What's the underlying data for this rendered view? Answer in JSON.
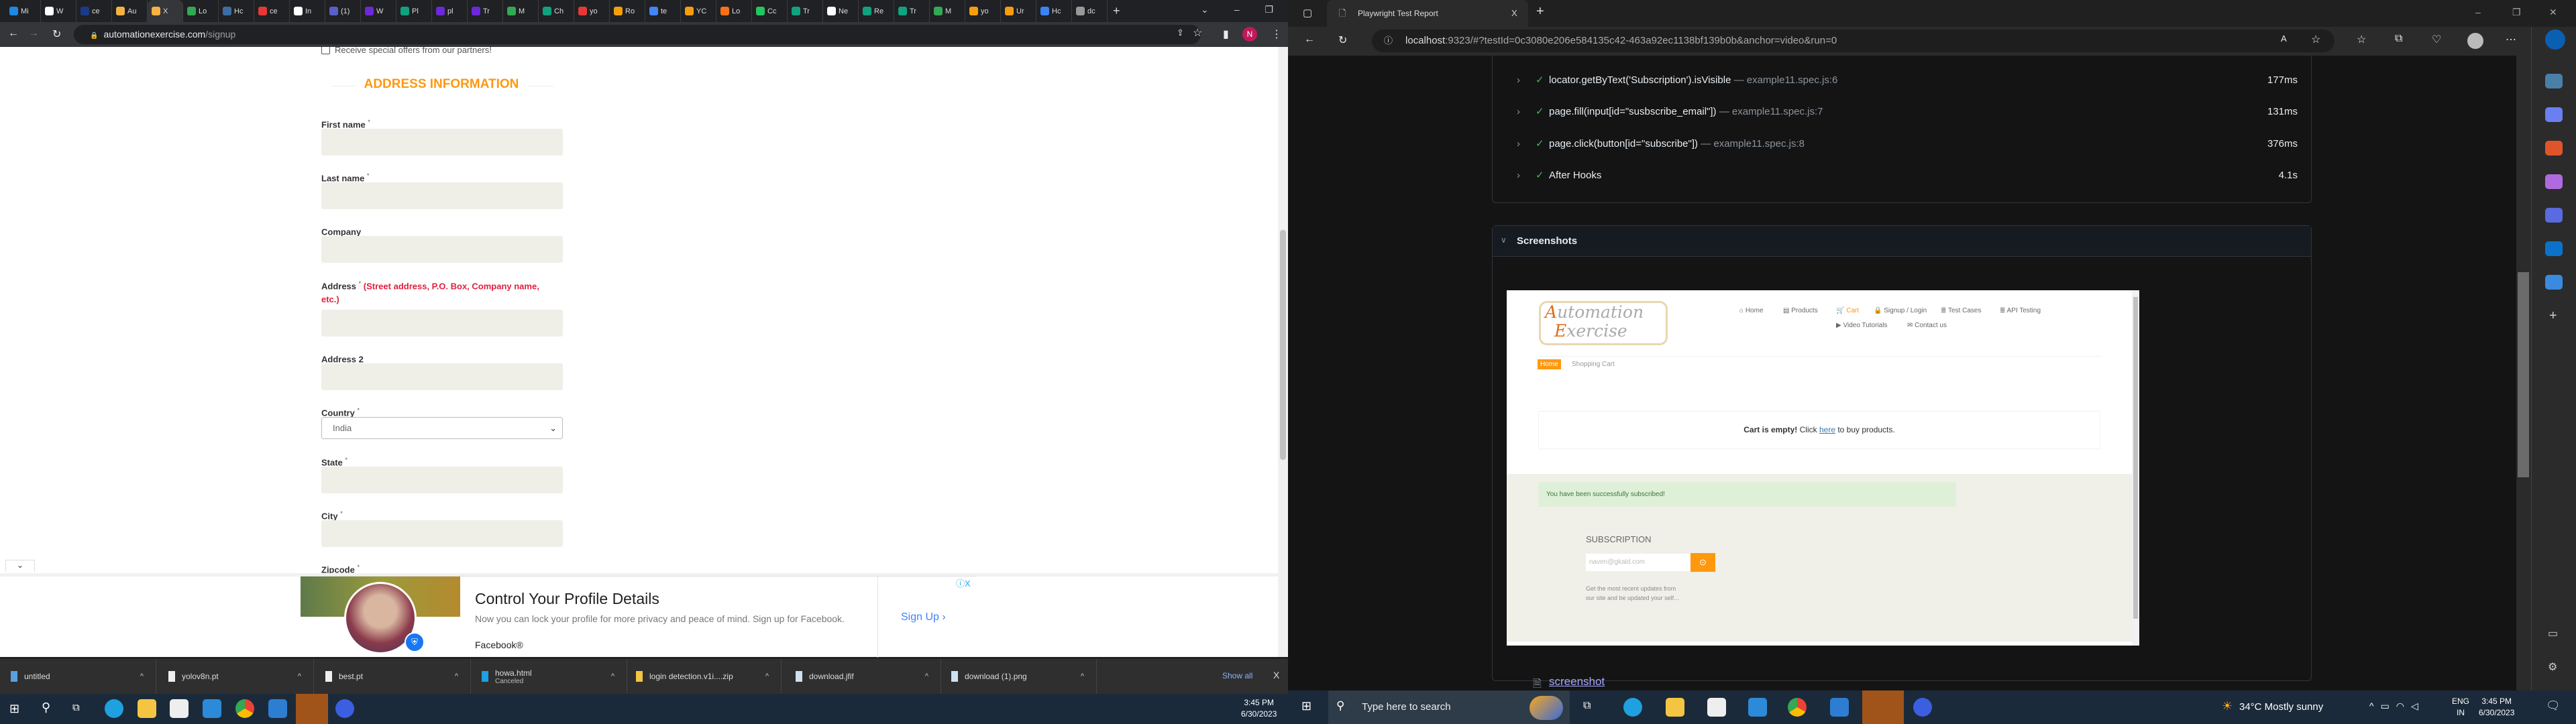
{
  "left_browser": {
    "tabs": [
      "Mi",
      "W",
      "ce",
      "Au",
      "X",
      "Lo",
      "Hc",
      "ce",
      "In",
      "(1)",
      "W",
      "Pl",
      "pl",
      "Tr",
      "M",
      "Ch",
      "yo",
      "Ro",
      "te",
      "YC",
      "Lo",
      "Cc",
      "Tr",
      "Ne",
      "Re",
      "Tr",
      "M",
      "yo",
      "Ur",
      "Hc",
      "dc"
    ],
    "active_tab_index": 4,
    "new_tab": "+",
    "window_controls": [
      "⌄",
      "–",
      "❐",
      "✕"
    ],
    "url_host": "automationexercise.com",
    "url_path": "/signup",
    "profile_initial": "N"
  },
  "signup": {
    "offers_checkbox": "Receive special offers from our partners!",
    "heading": "ADDRESS INFORMATION",
    "heading_color": "#FE980F",
    "fields": [
      {
        "label": "First name",
        "required": "*"
      },
      {
        "label": "Last name",
        "required": "*"
      },
      {
        "label": "Company",
        "required": ""
      },
      {
        "label": "Address",
        "required": "*",
        "hint": "(Street address, P.O. Box, Company name,",
        "hint2": "etc.)"
      },
      {
        "label": "Address 2",
        "required": ""
      },
      {
        "label": "Country",
        "required": "*",
        "value": "India"
      },
      {
        "label": "State",
        "required": "*"
      },
      {
        "label": "City",
        "required": "*"
      },
      {
        "label": "Zipcode",
        "required": "*"
      }
    ]
  },
  "ad": {
    "title": "Control Your Profile Details",
    "body": "Now you can lock your profile for more privacy and peace of mind. Sign up for Facebook.",
    "advertiser": "Facebook®",
    "cta": "Sign Up",
    "info": "ⓘ",
    "close": "X"
  },
  "downloads": {
    "items": [
      {
        "name": "untitled",
        "status": ""
      },
      {
        "name": "yolov8n.pt",
        "status": ""
      },
      {
        "name": "best.pt",
        "status": ""
      },
      {
        "name": "howa.html",
        "status": "Canceled"
      },
      {
        "name": "login detection.v1i....zip",
        "status": ""
      },
      {
        "name": "download.jfif",
        "status": ""
      },
      {
        "name": "download (1).png",
        "status": ""
      }
    ],
    "show_all": "Show all",
    "close": "X"
  },
  "left_taskbar": {
    "time": "3:45 PM",
    "date": "6/30/2023"
  },
  "right_browser": {
    "tab_title": "Playwright Test Report",
    "tab_close": "X",
    "new_tab": "+",
    "url_host": "localhost",
    "url_rest": ":9323/#?testId=0c3080e206e584135c42-463a92ec1138bf139b0b&anchor=video&run=0"
  },
  "report": {
    "steps": [
      {
        "title": "locator.getByText('Subscription').isVisible",
        "location": "— example11.spec.js:6",
        "duration": "177ms"
      },
      {
        "title": "page.fill(input[id=\"susbscribe_email\"])",
        "location": "— example11.spec.js:7",
        "duration": "131ms"
      },
      {
        "title": "page.click(button[id=\"subscribe\"])",
        "location": "— example11.spec.js:8",
        "duration": "376ms"
      },
      {
        "title": "After Hooks",
        "location": "",
        "duration": "4.1s"
      }
    ],
    "screenshots_header": "Screenshots",
    "screenshot_link": "screenshot"
  },
  "captured_page": {
    "logo_line1": "Automation",
    "logo_line2": "Exercise",
    "nav": [
      "Home",
      "Products",
      "Cart",
      "Signup / Login",
      "Test Cases",
      "API Testing",
      "Video Tutorials",
      "Contact us"
    ],
    "active_nav": "Cart",
    "breadcrumb_home": "Home",
    "breadcrumb_current": "Shopping Cart",
    "cart_empty_bold": "Cart is empty!",
    "cart_empty_pre": " Click ",
    "cart_empty_link": "here",
    "cart_empty_post": " to buy products.",
    "success_alert": "You have been successfully subscribed!",
    "subscription_title": "SUBSCRIPTION",
    "email_value": "naven@gkald.com",
    "subscription_text1": "Get the most recent updates from",
    "subscription_text2": "our site and be updated your self..."
  },
  "right_taskbar": {
    "search_placeholder": "Type here to search",
    "weather": "34°C  Mostly sunny",
    "lang1": "ENG",
    "lang2": "IN",
    "time": "3:45 PM",
    "date": "6/30/2023"
  }
}
